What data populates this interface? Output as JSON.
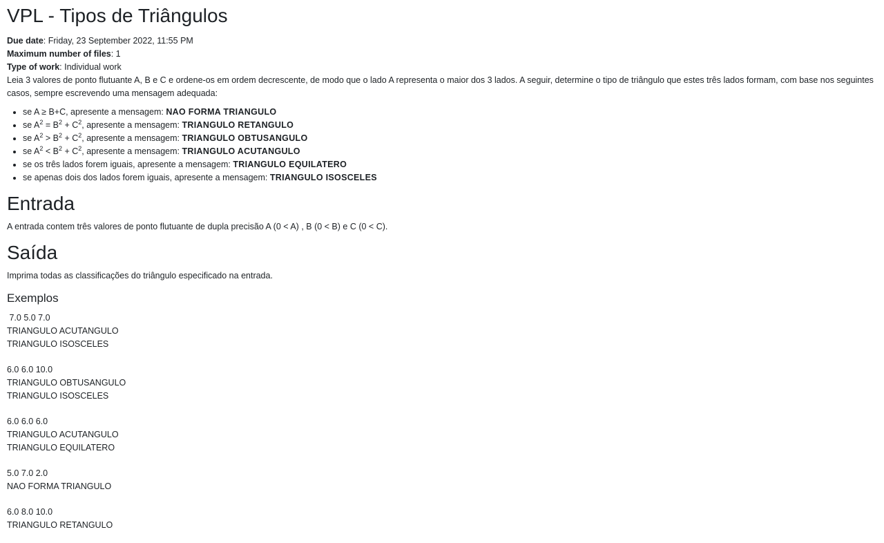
{
  "title": "VPL - Tipos de Triângulos",
  "meta": {
    "due_label": "Due date",
    "due_value": ": Friday, 23 September 2022, 11:55 PM",
    "max_label": "Maximum number of files",
    "max_value": ": 1",
    "type_label": "Type of work",
    "type_value": ": Individual work"
  },
  "description": "Leia 3 valores de ponto flutuante A, B e C e ordene-os em ordem decrescente, de modo que o lado A representa o maior dos 3 lados. A seguir, determine o tipo de triângulo que estes três lados formam, com base nos seguintes casos, sempre escrevendo uma mensagem adequada:",
  "cases": [
    {
      "cond": "se A ≥ B+C, apresente a mensagem: ",
      "msg": "NAO FORMA TRIANGULO"
    },
    {
      "a": "A",
      "s1": "2",
      "op": " = B",
      "s2": "2",
      "plus": " + C",
      "s3": "2",
      "tail": ", apresente a mensagem: ",
      "msg": "TRIANGULO RETANGULO"
    },
    {
      "a": "A",
      "s1": "2",
      "op": " > B",
      "s2": "2",
      "plus": " + C",
      "s3": "2",
      "tail": ", apresente a mensagem: ",
      "msg": "TRIANGULO OBTUSANGULO"
    },
    {
      "a": "A",
      "s1": "2",
      "op": " < B",
      "s2": "2",
      "plus": " + C",
      "s3": "2",
      "tail": ", apresente a mensagem: ",
      "msg": "TRIANGULO ACUTANGULO"
    },
    {
      "cond": "se os três lados forem iguais, apresente a mensagem: ",
      "msg": "TRIANGULO EQUILATERO"
    },
    {
      "cond": "se apenas dois dos lados forem iguais, apresente a mensagem: ",
      "msg": "TRIANGULO ISOSCELES"
    }
  ],
  "case_prefix": "se ",
  "entrada": {
    "heading": "Entrada",
    "text": "A entrada contem três valores de ponto flutuante de dupla precisão A (0 < A) , B (0 < B) e C (0 < C)."
  },
  "saida": {
    "heading": "Saída",
    "text": "Imprima todas as classificações do triângulo especificado na entrada."
  },
  "exemplos_heading": "Exemplos",
  "examples": [
    [
      " 7.0 5.0 7.0",
      "TRIANGULO ACUTANGULO",
      "TRIANGULO ISOSCELES"
    ],
    [
      "6.0 6.0 10.0",
      "TRIANGULO OBTUSANGULO",
      "TRIANGULO ISOSCELES"
    ],
    [
      "6.0 6.0 6.0",
      "TRIANGULO ACUTANGULO",
      "TRIANGULO EQUILATERO"
    ],
    [
      "5.0 7.0 2.0",
      "NAO FORMA TRIANGULO"
    ],
    [
      "6.0 8.0 10.0",
      "TRIANGULO RETANGULO"
    ]
  ]
}
